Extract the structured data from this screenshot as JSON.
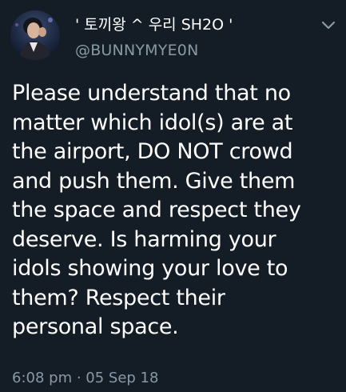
{
  "tweet": {
    "author": {
      "display_name": "' 토끼왕 ^ 우리 SH2O '",
      "handle": "@BUNNYMYE0N",
      "avatar_icon": "user-avatar-photo"
    },
    "menu_icon": "chevron-down-icon",
    "text": "Please understand that no\nmatter which idol(s) are at\nthe airport, DO NOT crowd\nand push them. Give them\nthe space and respect they\ndeserve. Is harming your\nidols showing your love to\nthem? Respect their\npersonal space.",
    "timestamp": "6:08 pm · 05 Sep 18"
  },
  "colors": {
    "background": "#141d26",
    "primary_text": "#ffffff",
    "secondary_text": "#8899a6"
  }
}
